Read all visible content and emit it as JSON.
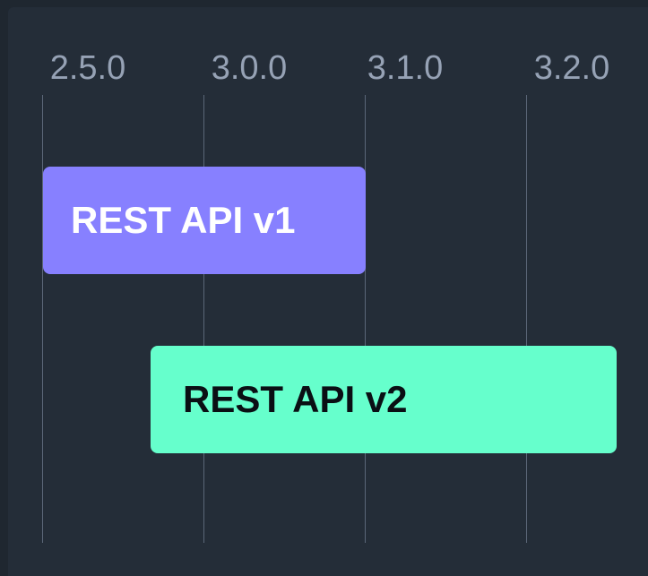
{
  "chart_data": {
    "type": "bar",
    "axis": {
      "ticks": [
        "2.5.0",
        "3.0.0",
        "3.1.0",
        "3.2.0"
      ],
      "grid": true
    },
    "bars": [
      {
        "label": "REST API v1",
        "start": "2.5.0",
        "end": "3.1.0",
        "color": "#8780ff",
        "text_color": "#ffffff"
      },
      {
        "label": "REST API v2",
        "start": "2.5.0 + 2/3",
        "end": "3.2.0 + 1/2",
        "color": "#66ffcc",
        "text_color": "#0a0f14"
      }
    ]
  },
  "colors": {
    "background": "#242d38",
    "gridline": "#5b6778",
    "tick_text": "#96a2b5"
  }
}
